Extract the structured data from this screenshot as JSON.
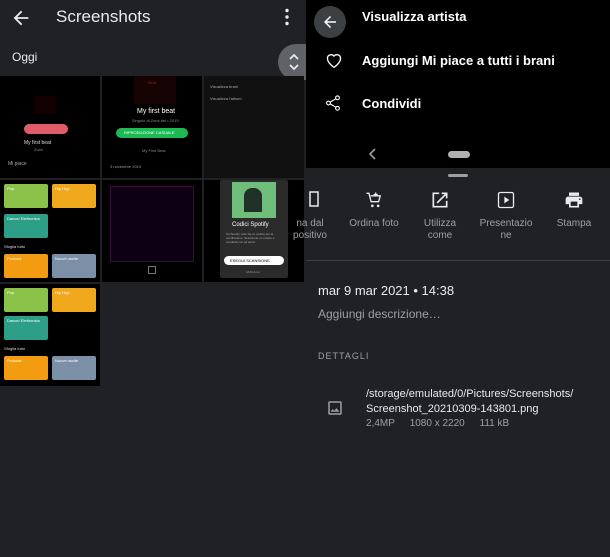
{
  "gallery": {
    "title": "Screenshots",
    "section": "Oggi",
    "tile1": {
      "track": "My first beat",
      "sub": "Zumi",
      "like": "Mi piace"
    },
    "tile2": {
      "cover": "Beat",
      "track": "My first beat",
      "sub": "Singolo di Zumi del • 2019",
      "shuffle": "RIPRODUZIONE CASUALE",
      "album": "My First Beat",
      "date": "3 novembre 2019"
    },
    "tile3": {
      "line1": "Visualizza brani",
      "line2": "Visualizza l'album"
    },
    "cats": {
      "pop": "Pop",
      "hiphop": "Hip Hop",
      "dance": "Dance/ Elettronica",
      "browse": "Sfoglia tutto",
      "podcast": "Podcast",
      "new": "Nuove uscite"
    },
    "tile6": {
      "title": "Codici Spotify",
      "desc": "Su Spotify, tutto ha un codice per la condivisione. Scansiona un codice e condividi con gli amici.",
      "scan": "ESEGUI SCANSIONE",
      "close": "ANNULLA"
    }
  },
  "menu": {
    "items": [
      {
        "label": "Visualizza artista"
      },
      {
        "label": "Aggiungi Mi piace a tutti i brani"
      },
      {
        "label": "Condividi"
      }
    ]
  },
  "sheet": {
    "actions": [
      {
        "label1": "na dal",
        "label2": "positivo"
      },
      {
        "label1": "Ordina foto",
        "label2": ""
      },
      {
        "label1": "Utilizza",
        "label2": "come"
      },
      {
        "label1": "Presentazio",
        "label2": "ne"
      },
      {
        "label1": "Stampa",
        "label2": ""
      }
    ],
    "date": "mar 9 mar 2021 • 14:38",
    "description_placeholder": "Aggiungi descrizione…",
    "details_header": "DETTAGLI",
    "file": {
      "path_line1": "/storage/emulated/0/Pictures/Screenshots/",
      "path_line2": "Screenshot_20210309-143801.png",
      "megapixels": "2,4MP",
      "resolution": "1080 x 2220",
      "size": "111 kB"
    }
  }
}
